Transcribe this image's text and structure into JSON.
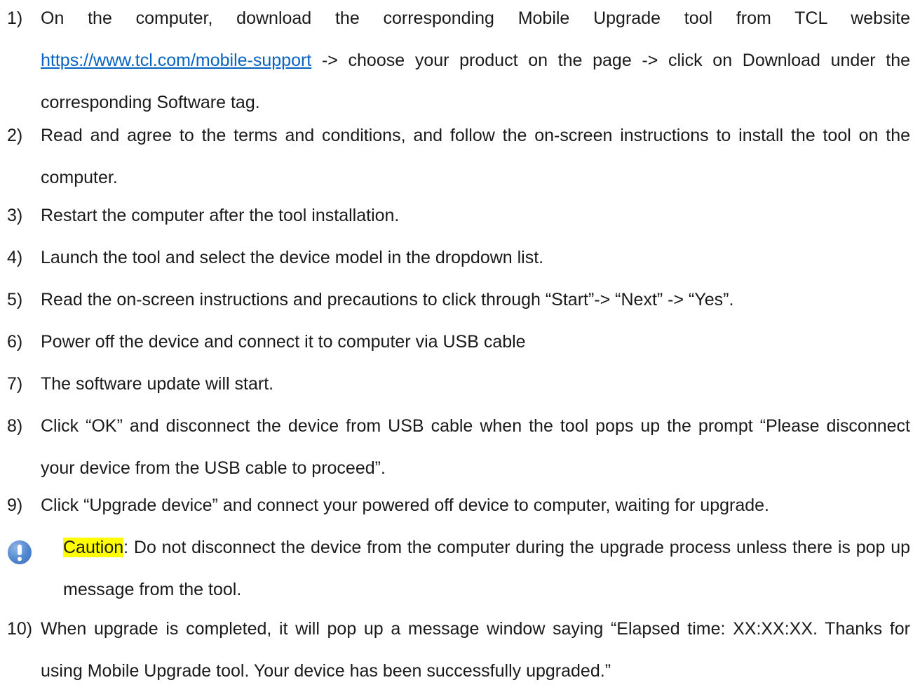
{
  "steps": [
    {
      "num": "1)",
      "before": "On the computer, download the corresponding Mobile Upgrade tool from TCL website ",
      "link": "https://www.tcl.com/mobile-support",
      "after": " -> choose your product on the page -> click on Download under the corresponding Software tag."
    },
    {
      "num": "2)",
      "text": "Read and agree to the terms and conditions, and follow the on-screen instructions to install the tool on the computer."
    },
    {
      "num": "3)",
      "text": "Restart the computer after the tool installation."
    },
    {
      "num": "4)",
      "text": "Launch the tool and select the device model in the dropdown list."
    },
    {
      "num": "5)",
      "text": "Read the on-screen instructions and precautions to click through “Start”-> “Next” -> “Yes”."
    },
    {
      "num": "6)",
      "text": "Power off the device and connect it to computer via USB cable"
    },
    {
      "num": "7)",
      "text": "The software update will start."
    },
    {
      "num": "8)",
      "text": "Click “OK” and disconnect the device from USB cable when the tool pops up the prompt “Please disconnect your device from the USB cable to proceed”."
    },
    {
      "num": "9)",
      "text": "Click “Upgrade device” and connect your powered off device to computer, waiting for upgrade."
    },
    {
      "num": "10)",
      "text": "When upgrade is completed, it will pop up a message window saying “Elapsed time: XX:XX:XX. Thanks for using Mobile Upgrade tool. Your device has been successfully upgraded.”"
    }
  ],
  "caution": {
    "label": "Caution",
    "text": ": Do not disconnect the device from the computer during the upgrade process unless there is pop up message from the tool.",
    "icon": "exclamation-icon",
    "highlight_color": "#ffff00",
    "icon_color": "#4f86cf"
  },
  "colors": {
    "link": "#0563c1",
    "text": "#1a1a1a"
  }
}
